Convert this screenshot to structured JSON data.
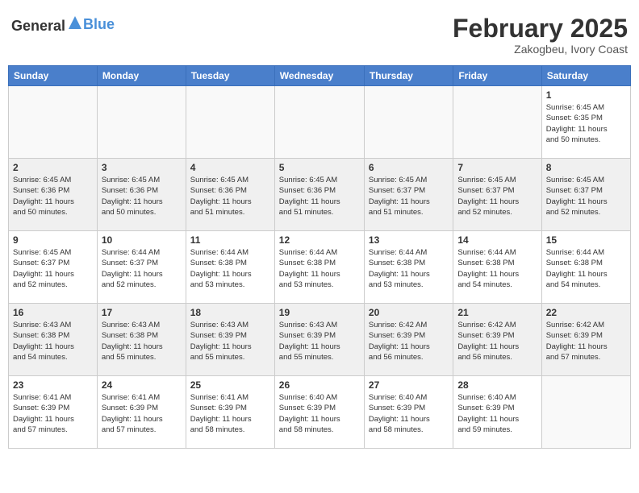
{
  "header": {
    "logo_general": "General",
    "logo_blue": "Blue",
    "month_year": "February 2025",
    "location": "Zakogbeu, Ivory Coast"
  },
  "weekdays": [
    "Sunday",
    "Monday",
    "Tuesday",
    "Wednesday",
    "Thursday",
    "Friday",
    "Saturday"
  ],
  "weeks": [
    [
      {
        "day": "",
        "info": ""
      },
      {
        "day": "",
        "info": ""
      },
      {
        "day": "",
        "info": ""
      },
      {
        "day": "",
        "info": ""
      },
      {
        "day": "",
        "info": ""
      },
      {
        "day": "",
        "info": ""
      },
      {
        "day": "1",
        "info": "Sunrise: 6:45 AM\nSunset: 6:35 PM\nDaylight: 11 hours\nand 50 minutes."
      }
    ],
    [
      {
        "day": "2",
        "info": "Sunrise: 6:45 AM\nSunset: 6:36 PM\nDaylight: 11 hours\nand 50 minutes."
      },
      {
        "day": "3",
        "info": "Sunrise: 6:45 AM\nSunset: 6:36 PM\nDaylight: 11 hours\nand 50 minutes."
      },
      {
        "day": "4",
        "info": "Sunrise: 6:45 AM\nSunset: 6:36 PM\nDaylight: 11 hours\nand 51 minutes."
      },
      {
        "day": "5",
        "info": "Sunrise: 6:45 AM\nSunset: 6:36 PM\nDaylight: 11 hours\nand 51 minutes."
      },
      {
        "day": "6",
        "info": "Sunrise: 6:45 AM\nSunset: 6:37 PM\nDaylight: 11 hours\nand 51 minutes."
      },
      {
        "day": "7",
        "info": "Sunrise: 6:45 AM\nSunset: 6:37 PM\nDaylight: 11 hours\nand 52 minutes."
      },
      {
        "day": "8",
        "info": "Sunrise: 6:45 AM\nSunset: 6:37 PM\nDaylight: 11 hours\nand 52 minutes."
      }
    ],
    [
      {
        "day": "9",
        "info": "Sunrise: 6:45 AM\nSunset: 6:37 PM\nDaylight: 11 hours\nand 52 minutes."
      },
      {
        "day": "10",
        "info": "Sunrise: 6:44 AM\nSunset: 6:37 PM\nDaylight: 11 hours\nand 52 minutes."
      },
      {
        "day": "11",
        "info": "Sunrise: 6:44 AM\nSunset: 6:38 PM\nDaylight: 11 hours\nand 53 minutes."
      },
      {
        "day": "12",
        "info": "Sunrise: 6:44 AM\nSunset: 6:38 PM\nDaylight: 11 hours\nand 53 minutes."
      },
      {
        "day": "13",
        "info": "Sunrise: 6:44 AM\nSunset: 6:38 PM\nDaylight: 11 hours\nand 53 minutes."
      },
      {
        "day": "14",
        "info": "Sunrise: 6:44 AM\nSunset: 6:38 PM\nDaylight: 11 hours\nand 54 minutes."
      },
      {
        "day": "15",
        "info": "Sunrise: 6:44 AM\nSunset: 6:38 PM\nDaylight: 11 hours\nand 54 minutes."
      }
    ],
    [
      {
        "day": "16",
        "info": "Sunrise: 6:43 AM\nSunset: 6:38 PM\nDaylight: 11 hours\nand 54 minutes."
      },
      {
        "day": "17",
        "info": "Sunrise: 6:43 AM\nSunset: 6:38 PM\nDaylight: 11 hours\nand 55 minutes."
      },
      {
        "day": "18",
        "info": "Sunrise: 6:43 AM\nSunset: 6:39 PM\nDaylight: 11 hours\nand 55 minutes."
      },
      {
        "day": "19",
        "info": "Sunrise: 6:43 AM\nSunset: 6:39 PM\nDaylight: 11 hours\nand 55 minutes."
      },
      {
        "day": "20",
        "info": "Sunrise: 6:42 AM\nSunset: 6:39 PM\nDaylight: 11 hours\nand 56 minutes."
      },
      {
        "day": "21",
        "info": "Sunrise: 6:42 AM\nSunset: 6:39 PM\nDaylight: 11 hours\nand 56 minutes."
      },
      {
        "day": "22",
        "info": "Sunrise: 6:42 AM\nSunset: 6:39 PM\nDaylight: 11 hours\nand 57 minutes."
      }
    ],
    [
      {
        "day": "23",
        "info": "Sunrise: 6:41 AM\nSunset: 6:39 PM\nDaylight: 11 hours\nand 57 minutes."
      },
      {
        "day": "24",
        "info": "Sunrise: 6:41 AM\nSunset: 6:39 PM\nDaylight: 11 hours\nand 57 minutes."
      },
      {
        "day": "25",
        "info": "Sunrise: 6:41 AM\nSunset: 6:39 PM\nDaylight: 11 hours\nand 58 minutes."
      },
      {
        "day": "26",
        "info": "Sunrise: 6:40 AM\nSunset: 6:39 PM\nDaylight: 11 hours\nand 58 minutes."
      },
      {
        "day": "27",
        "info": "Sunrise: 6:40 AM\nSunset: 6:39 PM\nDaylight: 11 hours\nand 58 minutes."
      },
      {
        "day": "28",
        "info": "Sunrise: 6:40 AM\nSunset: 6:39 PM\nDaylight: 11 hours\nand 59 minutes."
      },
      {
        "day": "",
        "info": ""
      }
    ]
  ]
}
